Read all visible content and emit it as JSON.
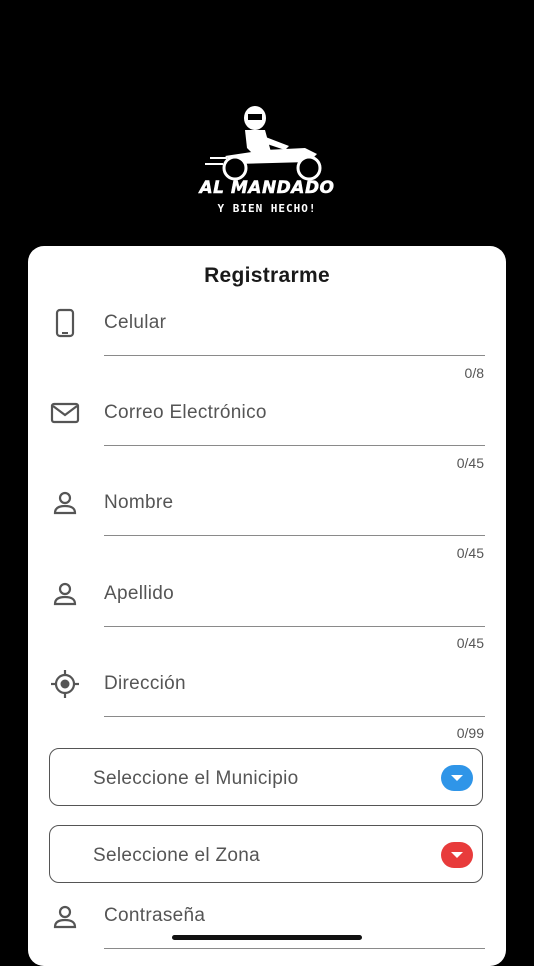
{
  "logo": {
    "brand": "AL MANDADO",
    "tagline": "Y BIEN HECHO!"
  },
  "form": {
    "title": "Registrarme",
    "fields": [
      {
        "label": "Celular",
        "counter": "0/8",
        "icon": "phone-icon"
      },
      {
        "label": "Correo Electrónico",
        "counter": "0/45",
        "icon": "mail-icon"
      },
      {
        "label": "Nombre",
        "counter": "0/45",
        "icon": "person-icon"
      },
      {
        "label": "Apellido",
        "counter": "0/45",
        "icon": "person-icon"
      },
      {
        "label": "Dirección",
        "counter": "0/99",
        "icon": "location-icon"
      }
    ],
    "selects": [
      {
        "label": "Seleccione el Municipio",
        "color": "#2f95e8"
      },
      {
        "label": "Seleccione el Zona",
        "color": "#e83b3b"
      }
    ],
    "password": {
      "label": "Contraseña",
      "icon": "person-icon"
    }
  }
}
